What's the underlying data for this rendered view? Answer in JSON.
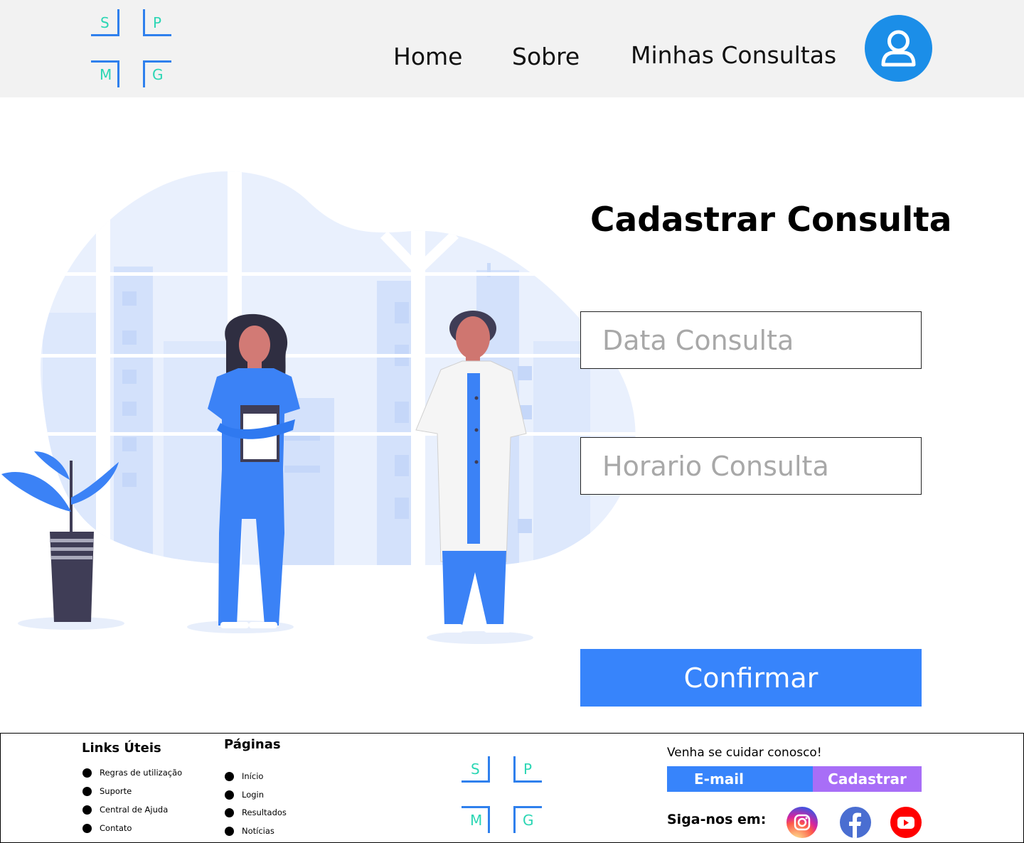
{
  "header": {
    "logo": {
      "letters": [
        "S",
        "P",
        "M",
        "G"
      ]
    },
    "nav": [
      {
        "label": "Home"
      },
      {
        "label": "Sobre"
      },
      {
        "label": "Minhas Consultas"
      }
    ],
    "avatar_icon": "user-icon"
  },
  "illustration": {
    "icon": "doctors-illustration"
  },
  "form": {
    "title": "Cadastrar Consulta",
    "date_placeholder": "Data Consulta",
    "time_placeholder": "Horario Consulta",
    "confirm_label": "Confirmar"
  },
  "footer": {
    "links": {
      "title": "Links Úteis",
      "items": [
        "Regras de utilização",
        "Suporte",
        "Central de Ajuda",
        "Contato"
      ]
    },
    "pages": {
      "title": "Páginas",
      "items": [
        "Início",
        "Login",
        "Resultados",
        "Notícias"
      ]
    },
    "logo": {
      "letters": [
        "S",
        "P",
        "M",
        "G"
      ]
    },
    "cta_text": "Venha se cuidar conosco!",
    "email_placeholder": "E-mail",
    "signup_label": "Cadastrar",
    "follow_label": "Siga-nos em:",
    "social": [
      "instagram-icon",
      "facebook-icon",
      "youtube-icon"
    ]
  },
  "colors": {
    "header_bg": "#f2f2f2",
    "primary": "#3784fb",
    "signup": "#a86ef7",
    "logo_lines": "#2f80ed",
    "logo_letters": "#2bd6b4",
    "avatar": "#1b8ee8"
  }
}
